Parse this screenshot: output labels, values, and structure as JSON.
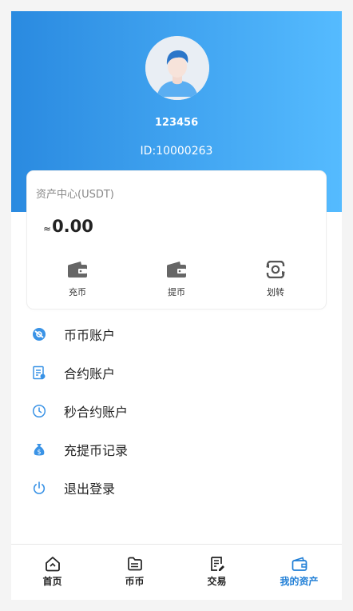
{
  "profile": {
    "username": "123456",
    "id_text": "ID:10000263"
  },
  "asset_card": {
    "title": "资产中心(USDT)",
    "approx_symbol": "≈",
    "balance": "0.00",
    "actions": [
      {
        "label": "充币",
        "icon": "wallet-icon"
      },
      {
        "label": "提币",
        "icon": "wallet-icon"
      },
      {
        "label": "划转",
        "icon": "transfer-icon"
      }
    ]
  },
  "menu": {
    "items": [
      {
        "label": "币币账户",
        "icon": "spot-account-icon"
      },
      {
        "label": "合约账户",
        "icon": "contract-account-icon"
      },
      {
        "label": "秒合约账户",
        "icon": "clock-icon"
      },
      {
        "label": "充提币记录",
        "icon": "money-bag-icon"
      },
      {
        "label": "退出登录",
        "icon": "power-icon"
      }
    ]
  },
  "tabbar": {
    "tabs": [
      {
        "label": "首页",
        "icon": "home-icon",
        "active": false
      },
      {
        "label": "币币",
        "icon": "folder-icon",
        "active": false
      },
      {
        "label": "交易",
        "icon": "document-icon",
        "active": false
      },
      {
        "label": "我的资产",
        "icon": "wallet-icon",
        "active": true
      }
    ]
  },
  "colors": {
    "header_gradient_start": "#2a8ae0",
    "header_gradient_end": "#55bbff",
    "accent": "#1f7ed6",
    "menu_icon": "#3a93e6"
  }
}
